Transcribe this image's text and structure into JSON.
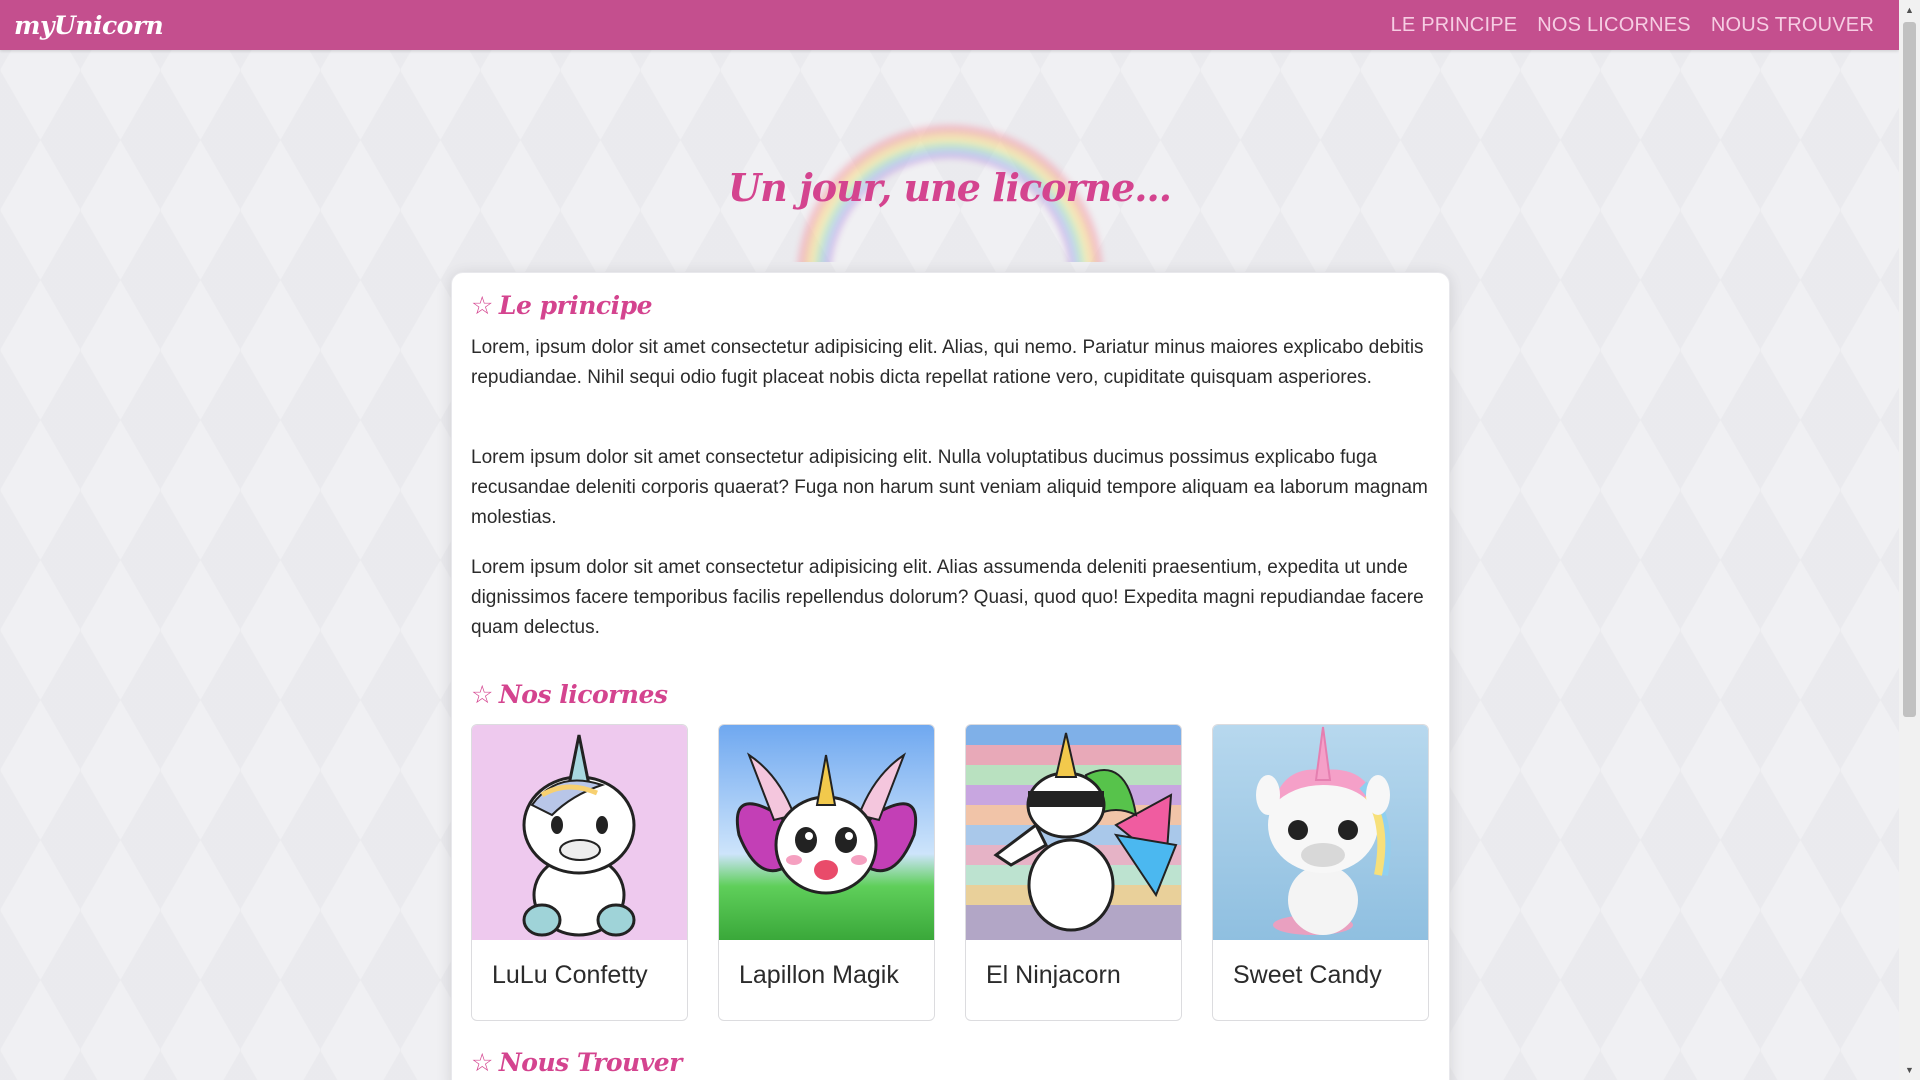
{
  "navbar": {
    "brand": "myUnicorn",
    "links": [
      "LE PRINCIPE",
      "NOS LICORNES",
      "NOUS TROUVER"
    ]
  },
  "hero": {
    "title": "Un jour, une licorne..."
  },
  "principe": {
    "title": "Le principe",
    "paragraphs": [
      "Lorem, ipsum dolor sit amet consectetur adipisicing elit. Alias, qui nemo. Pariatur minus maiores explicabo debitis repudiandae. Nihil sequi odio fugit placeat nobis dicta repellat ratione vero, cupiditate quisquam asperiores.",
      "Lorem ipsum dolor sit amet consectetur adipisicing elit. Nulla voluptatibus ducimus possimus explicabo fuga recusandae deleniti corporis quaerat? Fuga non harum sunt veniam aliquid tempore aliquam ea laborum magnam molestias.",
      "Lorem ipsum dolor sit amet consectetur adipisicing elit. Alias assumenda deleniti praesentium, expedita ut unde dignissimos facere temporibus facilis repellendus dolorum? Quasi, quod quo! Expedita magni repudiandae facere quam delectus."
    ]
  },
  "licornes": {
    "title": "Nos licornes",
    "items": [
      {
        "name": "LuLu Confetty",
        "image": "white-unicorn-icon"
      },
      {
        "name": "Lapillon Magik",
        "image": "butterfly-unicorn-icon"
      },
      {
        "name": "El Ninjacorn",
        "image": "ninja-unicorn-icon"
      },
      {
        "name": "Sweet Candy",
        "image": "candy-unicorn-icon"
      }
    ]
  },
  "trouver": {
    "title": "Nous Trouver"
  },
  "icons": {
    "section_star": "☆"
  },
  "colors": {
    "navbar": "#c44f8e",
    "accent": "#d4448f",
    "nav_link": "#f6cde3"
  }
}
